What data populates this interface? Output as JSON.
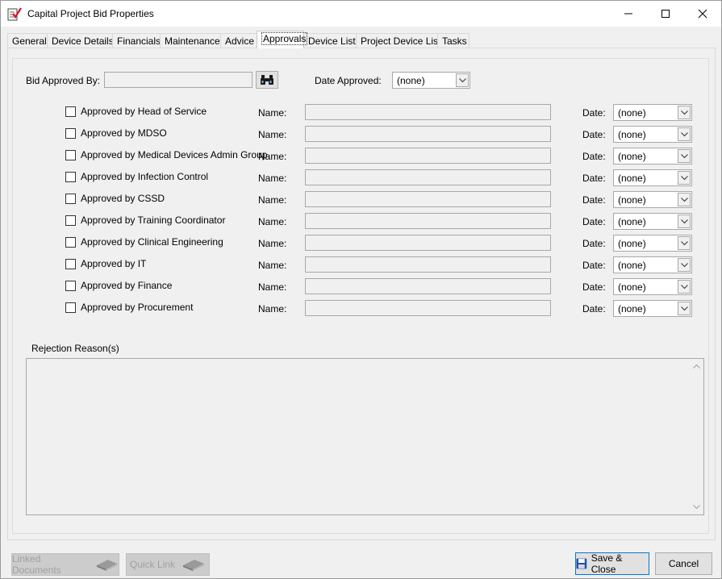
{
  "window": {
    "title": "Capital Project Bid Properties"
  },
  "tabs": [
    {
      "label": "General"
    },
    {
      "label": "Device Details"
    },
    {
      "label": "Financials"
    },
    {
      "label": "Maintenance"
    },
    {
      "label": "Advice"
    },
    {
      "label": "Approvals"
    },
    {
      "label": "Device List"
    },
    {
      "label": "Project Device List"
    },
    {
      "label": "Tasks"
    }
  ],
  "bid": {
    "approved_by_label": "Bid Approved By:",
    "approved_by_value": "",
    "date_approved_label": "Date Approved:",
    "date_approved_value": "(none)"
  },
  "approvals": {
    "name_label": "Name:",
    "date_label": "Date:",
    "rows": [
      {
        "label": "Approved by Head of Service",
        "name": "",
        "date": "(none)",
        "checked": false
      },
      {
        "label": "Approved by MDSO",
        "name": "",
        "date": "(none)",
        "checked": false
      },
      {
        "label": "Approved by Medical Devices Admin Group",
        "name": "",
        "date": "(none)",
        "checked": false
      },
      {
        "label": "Approved by Infection Control",
        "name": "",
        "date": "(none)",
        "checked": false
      },
      {
        "label": "Approved by CSSD",
        "name": "",
        "date": "(none)",
        "checked": false
      },
      {
        "label": "Approved by Training Coordinator",
        "name": "",
        "date": "(none)",
        "checked": false
      },
      {
        "label": "Approved by Clinical Engineering",
        "name": "",
        "date": "(none)",
        "checked": false
      },
      {
        "label": "Approved by IT",
        "name": "",
        "date": "(none)",
        "checked": false
      },
      {
        "label": "Approved by Finance",
        "name": "",
        "date": "(none)",
        "checked": false
      },
      {
        "label": "Approved by Procurement",
        "name": "",
        "date": "(none)",
        "checked": false
      }
    ]
  },
  "rejection": {
    "label": "Rejection Reason(s)",
    "value": ""
  },
  "footer": {
    "linked_documents": "Linked Documents",
    "quick_link": "Quick Link",
    "save_close": "Save & Close",
    "cancel": "Cancel"
  },
  "icons": {
    "app": "report-check-icon",
    "find": "binoculars-icon",
    "book": "book-icon",
    "save": "floppy-disk-icon"
  },
  "colors": {
    "accent": "#0078d7",
    "disabled_text": "#a0a0a0"
  }
}
